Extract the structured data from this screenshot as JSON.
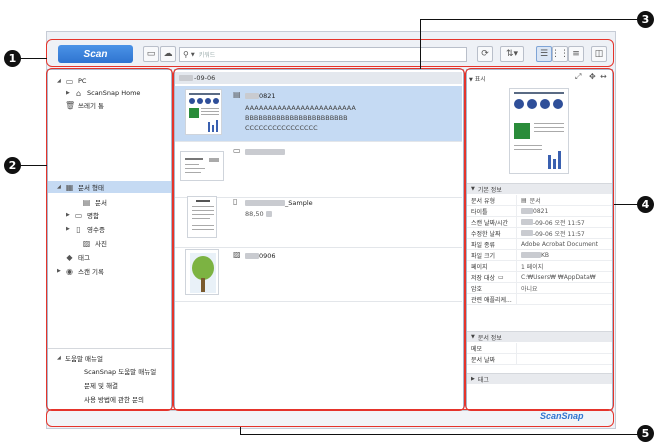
{
  "callouts": [
    "1",
    "2",
    "3",
    "4",
    "5"
  ],
  "toolbar": {
    "scan_label": "Scan",
    "search_placeholder": "키워드"
  },
  "nav": {
    "pc": "PC",
    "scansnap_home": "ScanSnap Home",
    "trash": "쓰레기 통",
    "doc_type": "문서 형태",
    "document": "문서",
    "business_card": "명함",
    "receipt": "영수증",
    "photo": "사진",
    "tag": "태그",
    "scan_history": "스캔 기록"
  },
  "help": {
    "title": "도움말 매뉴얼",
    "items": [
      "ScanSnap 도움말 매뉴얼",
      "문제 및 해결",
      "사용 방법에 관한 문의"
    ]
  },
  "list": {
    "date_header": "-09-06",
    "rows": [
      {
        "name": "0821",
        "lines": [
          "AAAAAAAAAAAAAAAAAAAAAAAA",
          "BBBBBBBBBBBBBBBBBBBBBBB",
          "CCCCCCCCCCCCCCCC"
        ],
        "selected": true
      },
      {
        "name": "",
        "lines": [],
        "selected": false
      },
      {
        "name": "_Sample",
        "lines": [
          "88,50"
        ],
        "selected": false
      },
      {
        "name": "0906",
        "lines": [],
        "selected": false
      }
    ]
  },
  "detail": {
    "display_label": "표시",
    "basic_header": "기본 정보",
    "props": [
      {
        "k": "문서 유형",
        "v": "문서"
      },
      {
        "k": "타이틀",
        "v": "0821"
      },
      {
        "k": "스캔 날짜/시간",
        "v": "-09-06 오전 11:57"
      },
      {
        "k": "수정한 날짜",
        "v": "-09-06 오전 11:57"
      },
      {
        "k": "파일 종류",
        "v": "Adobe Acrobat Document"
      },
      {
        "k": "파일 크기",
        "v": "KB"
      },
      {
        "k": "페이지",
        "v": "1 페이지"
      },
      {
        "k": "저장 대상",
        "v": "C:₩Users₩ ₩AppData₩"
      },
      {
        "k": "암호",
        "v": "아니요"
      },
      {
        "k": "관련 애플리케...",
        "v": ""
      }
    ],
    "doc_info_header": "문서 정보",
    "doc_props": [
      {
        "k": "메모",
        "v": ""
      },
      {
        "k": "문서 날짜",
        "v": ""
      }
    ],
    "tag_header": "태그"
  },
  "status": {
    "brand": "ScanSnap"
  },
  "colors": {
    "accent": "#2f74d0",
    "selection": "#c5daf3",
    "callout_box": "#e5342b"
  }
}
